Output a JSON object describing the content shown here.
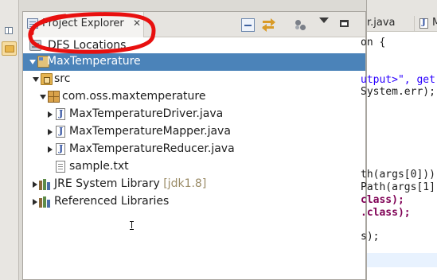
{
  "left_toolbar": {
    "items": [
      {
        "icon": "grid-icon"
      },
      {
        "icon": "folder-icon",
        "active": true
      }
    ]
  },
  "project_explorer": {
    "tab_label": "Project Explorer",
    "tab_close": "✕",
    "toolbar": [
      "collapse-all-icon",
      "link-with-editor-icon",
      "filter-icon",
      "view-menu-icon",
      "minimize-icon"
    ],
    "dfs_locations": {
      "label": "DFS Locations",
      "icon": "dfs-server-icon"
    },
    "tree": [
      {
        "label": "MaxTemperature",
        "icon": "project-icon",
        "expanded": true,
        "selected": true,
        "depth": 0
      },
      {
        "label": "src",
        "icon": "source-folder-icon",
        "expanded": true,
        "depth": 1
      },
      {
        "label": "com.oss.maxtemperature",
        "icon": "package-icon",
        "expanded": true,
        "depth": 2
      },
      {
        "label": "MaxTemperatureDriver.java",
        "icon": "java-file-icon",
        "expanded": false,
        "depth": 3
      },
      {
        "label": "MaxTemperatureMapper.java",
        "icon": "java-file-icon",
        "expanded": false,
        "depth": 3
      },
      {
        "label": "MaxTemperatureReducer.java",
        "icon": "java-file-icon",
        "expanded": false,
        "depth": 3
      },
      {
        "label": "sample.txt",
        "icon": "text-file-icon",
        "depth": 3
      },
      {
        "label": "JRE System Library",
        "suffix": "[jdk1.8]",
        "icon": "library-icon",
        "expanded": false,
        "depth": 1
      },
      {
        "label": "Referenced Libraries",
        "icon": "library-icon",
        "expanded": false,
        "depth": 1
      }
    ]
  },
  "annotation": {
    "shape": "hand-drawn circle",
    "color": "#e8100f"
  },
  "editor": {
    "tabs": [
      {
        "label": "r.java"
      },
      {
        "label": "M",
        "icon": "java-file-icon"
      }
    ],
    "code_lines": [
      {
        "text": "on {"
      },
      {
        "text": "utput>\", get"
      },
      {
        "text": "System.err);"
      },
      {
        "text": "th(args[0]))"
      },
      {
        "text": "Path(args[1]"
      },
      {
        "text": "class);"
      },
      {
        "text": ".class);"
      },
      {
        "text": "s);"
      }
    ]
  },
  "colors": {
    "selection": "#4b83b9",
    "annotation_red": "#e8100f",
    "view_background": "#ffffff",
    "chrome": "#dcdad5"
  }
}
